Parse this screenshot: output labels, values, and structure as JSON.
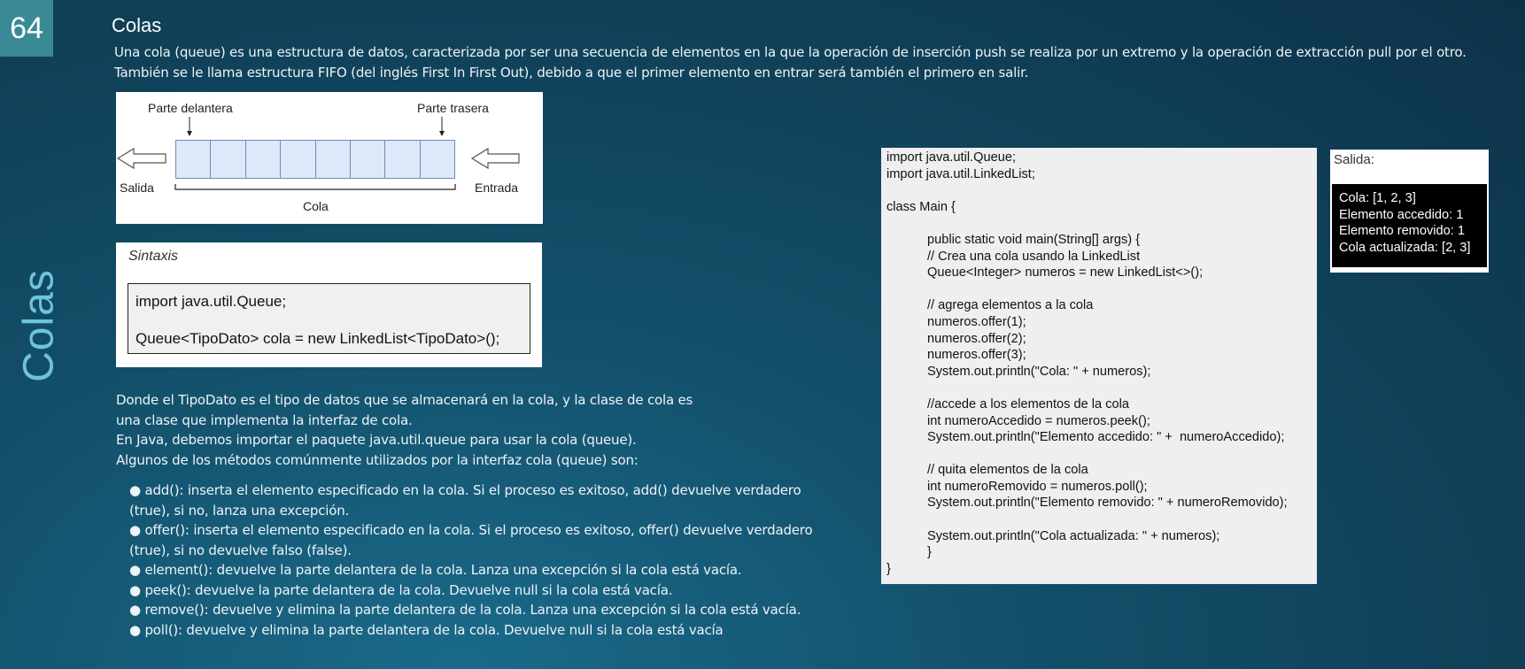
{
  "page_number": "64",
  "side_title": "Colas",
  "title": "Colas",
  "intro": "Una cola (queue) es una estructura de datos, caracterizada por ser una secuencia de elementos en la que la operación de inserción push se realiza por un extremo y la operación de extracción pull por el otro. También se le llama estructura FIFO (del inglés First In First Out), debido a que el primer elemento en entrar será también el primero en salir.",
  "diagram": {
    "front_label": "Parte delantera",
    "rear_label": "Parte trasera",
    "exit_label": "Salida",
    "entry_label": "Entrada",
    "queue_label": "Cola",
    "cell_count": 8
  },
  "syntax": {
    "heading": "Sintaxis",
    "line1": "import java.util.Queue;",
    "line2": "Queue<TipoDato> cola = new LinkedList<TipoDato>();"
  },
  "description": [
    "Donde el TipoDato es el tipo de datos que se almacenará en la cola, y la clase de cola es",
    "una clase que implementa la interfaz de cola.",
    "En Java, debemos importar el paquete java.util.queue para usar la cola (queue).",
    "Algunos de los métodos comúnmente utilizados por la interfaz cola (queue) son:"
  ],
  "methods": [
    "● add(): inserta el elemento especificado en la cola. Si el proceso es exitoso, add() devuelve verdadero",
    "(true), si no, lanza una excepción.",
    "● offer(): inserta el elemento especificado en la cola. Si el proceso es exitoso, offer() devuelve verdadero",
    "(true), si no devuelve falso (false).",
    "● element(): devuelve la parte delantera de la cola. Lanza una excepción si la cola está vacía.",
    "● peek(): devuelve la parte delantera de la cola. Devuelve null si la cola está vacía.",
    "● remove(): devuelve y elimina la parte delantera de la cola. Lanza una excepción si la cola está vacía.",
    "● poll(): devuelve y elimina la parte delantera de la cola. Devuelve null si la cola está vacía"
  ],
  "code": {
    "l01": "import java.util.Queue;",
    "l02": "import java.util.LinkedList;",
    "l03": "",
    "l04": "class Main {",
    "l05": "",
    "l06": "public static void main(String[] args) {",
    "l07": "// Crea una cola usando la LinkedList",
    "l08": "Queue<Integer> numeros = new LinkedList<>();",
    "l09": "",
    "l10": "// agrega elementos a la cola",
    "l11": "numeros.offer(1);",
    "l12": "numeros.offer(2);",
    "l13": "numeros.offer(3);",
    "l14": "System.out.println(\"Cola: \" + numeros);",
    "l15": "",
    "l16": "//accede a los elementos de la cola",
    "l17": "int numeroAccedido = numeros.peek();",
    "l18": "System.out.println(\"Elemento accedido: \" +  numeroAccedido);",
    "l19": "",
    "l20": "// quita elementos de la cola",
    "l21": "int numeroRemovido = numeros.poll();",
    "l22": "System.out.println(\"Elemento removido: \" + numeroRemovido);",
    "l23": "",
    "l24": "System.out.println(\"Cola actualizada: \" + numeros);",
    "l25": "}",
    "l26": "}"
  },
  "output": {
    "heading": "Salida:",
    "lines": [
      "Cola: [1, 2, 3]",
      "Elemento accedido: 1",
      "Elemento removido: 1",
      "Cola actualizada: [2, 3]"
    ]
  }
}
